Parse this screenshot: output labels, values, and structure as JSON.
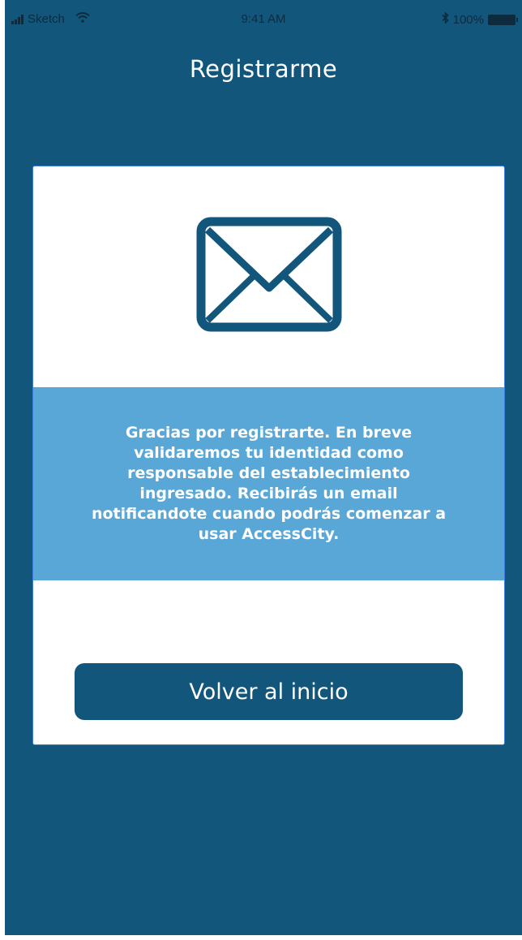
{
  "status_bar": {
    "carrier": "Sketch",
    "time": "9:41 AM",
    "battery": "100%"
  },
  "header": {
    "title": "Registrarme"
  },
  "card": {
    "icon": "envelope-icon",
    "message": "Gracias por registrarte. En breve validaremos tu identidad como responsable del establecimiento ingresado. Recibirás un email notificandote cuando podrás comenzar a usar AccessCity.",
    "button_label": "Volver al inicio"
  },
  "colors": {
    "background": "#13567c",
    "card": "#ffffff",
    "message_band": "#59a7d6",
    "button": "#13567c"
  }
}
